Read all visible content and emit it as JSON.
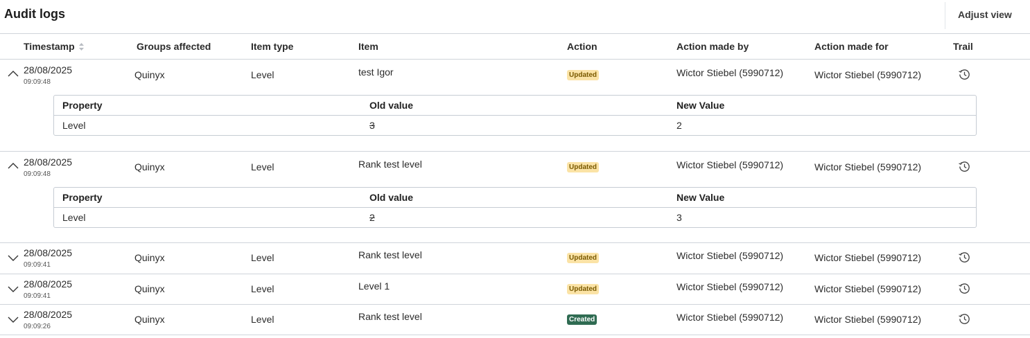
{
  "page": {
    "title": "Audit logs",
    "adjust_view_label": "Adjust view"
  },
  "columns": {
    "timestamp": "Timestamp",
    "groups": "Groups affected",
    "item_type": "Item type",
    "item": "Item",
    "action": "Action",
    "made_by": "Action made by",
    "made_for": "Action made for",
    "trail": "Trail"
  },
  "detail_columns": {
    "property": "Property",
    "old_value": "Old value",
    "new_value": "New Value"
  },
  "rows": [
    {
      "date": "28/08/2025",
      "time": "09:09:48",
      "group": "Quinyx",
      "item_type": "Level",
      "item": "test Igor",
      "action": "Updated",
      "made_by": "Wictor Stiebel (5990712)",
      "made_for": "Wictor Stiebel (5990712)",
      "expanded": true,
      "detail": {
        "property": "Level",
        "old_value": "3",
        "new_value": "2"
      }
    },
    {
      "date": "28/08/2025",
      "time": "09:09:48",
      "group": "Quinyx",
      "item_type": "Level",
      "item": "Rank test level",
      "action": "Updated",
      "made_by": "Wictor Stiebel (5990712)",
      "made_for": "Wictor Stiebel (5990712)",
      "expanded": true,
      "detail": {
        "property": "Level",
        "old_value": "2",
        "new_value": "3"
      }
    },
    {
      "date": "28/08/2025",
      "time": "09:09:41",
      "group": "Quinyx",
      "item_type": "Level",
      "item": "Rank test level",
      "action": "Updated",
      "made_by": "Wictor Stiebel (5990712)",
      "made_for": "Wictor Stiebel (5990712)",
      "expanded": false
    },
    {
      "date": "28/08/2025",
      "time": "09:09:41",
      "group": "Quinyx",
      "item_type": "Level",
      "item": "Level 1",
      "action": "Updated",
      "made_by": "Wictor Stiebel (5990712)",
      "made_for": "Wictor Stiebel (5990712)",
      "expanded": false
    },
    {
      "date": "28/08/2025",
      "time": "09:09:26",
      "group": "Quinyx",
      "item_type": "Level",
      "item": "Rank test level",
      "action": "Created",
      "made_by": "Wictor Stiebel (5990712)",
      "made_for": "Wictor Stiebel (5990712)",
      "expanded": false
    }
  ],
  "icons": {
    "sort": "sort-icon",
    "expand": "chevron-icon",
    "trail": "history-icon"
  },
  "colors": {
    "updated_badge_bg": "#fbe3a6",
    "created_badge_bg": "#2f6b52"
  }
}
